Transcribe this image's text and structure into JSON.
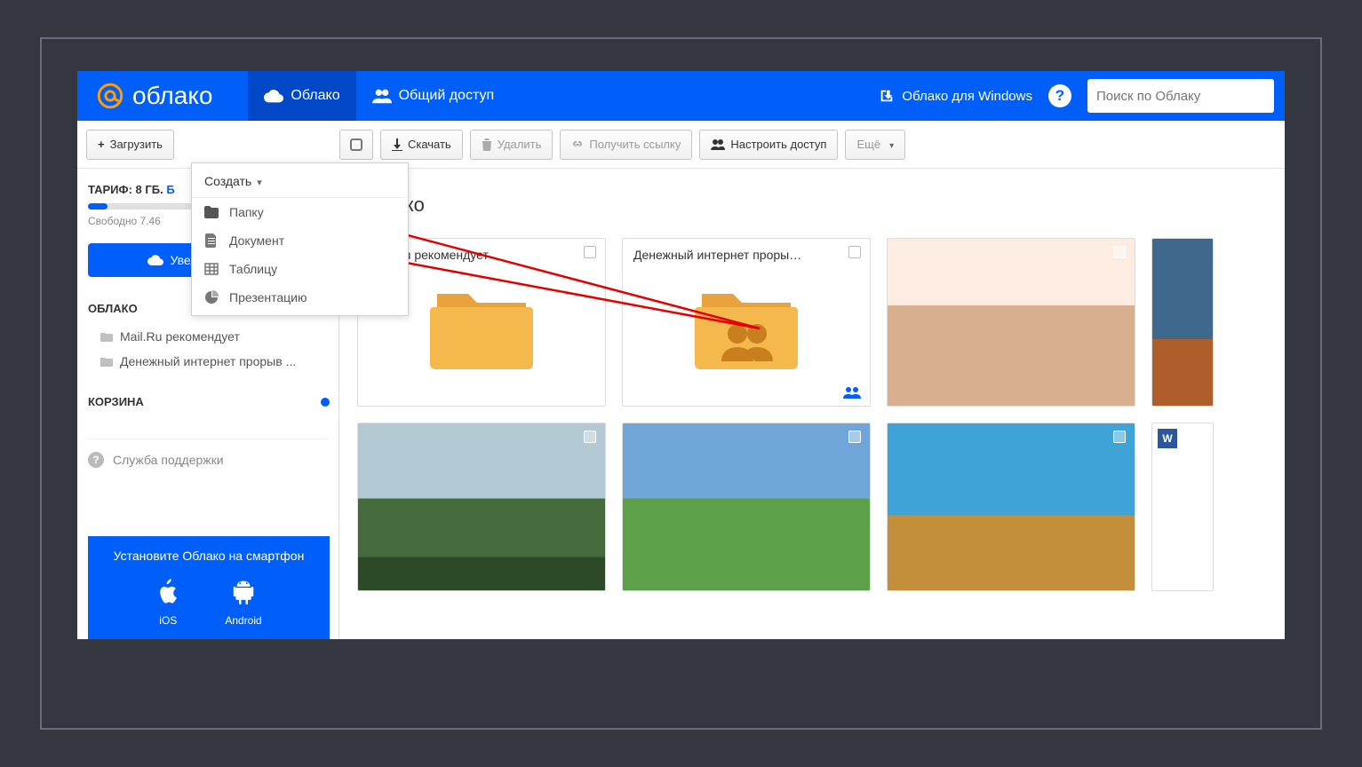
{
  "brand": {
    "title": "облако"
  },
  "nav": {
    "tab_cloud": "Облако",
    "tab_shared": "Общий доступ",
    "windows_link": "Облако для Windows",
    "search_placeholder": "Поиск по Облаку"
  },
  "toolbar": {
    "upload": "Загрузить",
    "create": "Создать",
    "download": "Скачать",
    "delete": "Удалить",
    "get_link": "Получить ссылку",
    "configure_access": "Настроить доступ",
    "more": "Ещё"
  },
  "create_menu": {
    "folder": "Папку",
    "document": "Документ",
    "table": "Таблицу",
    "presentation": "Презентацию"
  },
  "sidebar": {
    "tariff_label": "ТАРИФ: 8 ГБ.",
    "tariff_link": "Б",
    "free_space": "Свободно 7.46",
    "increase_btn": "Увеличить объем",
    "cloud_title": "ОБЛАКО",
    "items": [
      {
        "label": "Mail.Ru рекомендует"
      },
      {
        "label": "Денежный интернет прорыв ..."
      }
    ],
    "trash_title": "КОРЗИНА",
    "support": "Служба поддержки"
  },
  "promo": {
    "text": "Установите Облако на смартфон",
    "ios": "iOS",
    "android": "Android"
  },
  "main": {
    "breadcrumb": "Облако",
    "tiles": [
      {
        "kind": "folder",
        "label": "Mail.Ru рекомендует"
      },
      {
        "kind": "folder-shared",
        "label": "Денежный интернет проры…"
      },
      {
        "kind": "photo",
        "ph": "ph1"
      },
      {
        "kind": "photo-partial",
        "ph": "ph5"
      },
      {
        "kind": "photo",
        "ph": "ph2"
      },
      {
        "kind": "photo",
        "ph": "ph3"
      },
      {
        "kind": "photo",
        "ph": "ph4"
      },
      {
        "kind": "doc-partial"
      }
    ]
  }
}
